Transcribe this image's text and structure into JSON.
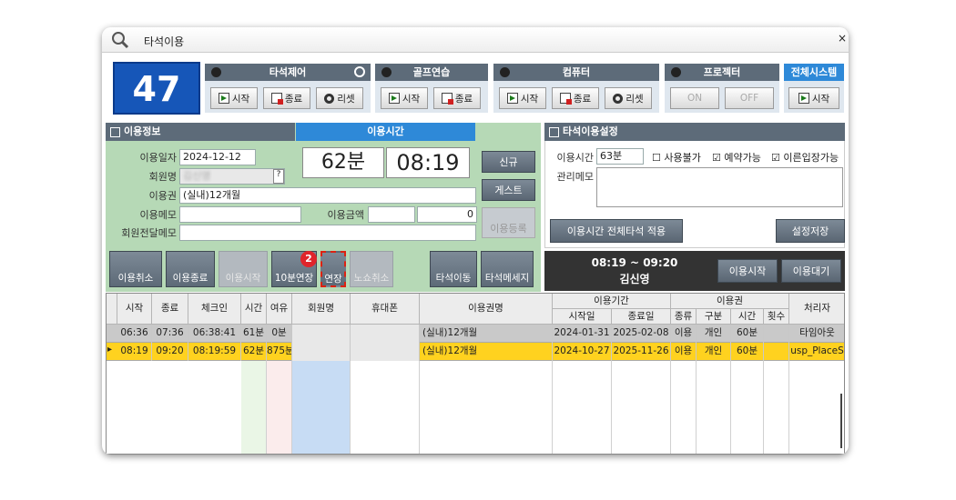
{
  "window": {
    "title": "타석이용",
    "close": "×"
  },
  "seat_number": "47",
  "groups": {
    "bay": {
      "title": "타석제어",
      "start": "시작",
      "end": "종료",
      "reset": "리셋"
    },
    "golf": {
      "title": "골프연습",
      "start": "시작",
      "end": "종료"
    },
    "computer": {
      "title": "컴퓨터",
      "start": "시작",
      "end": "종료",
      "reset": "리셋"
    },
    "projector": {
      "title": "프로젝터",
      "on": "ON",
      "off": "OFF"
    },
    "system": {
      "title": "전체시스템",
      "start": "시작"
    }
  },
  "usage_info": {
    "title": "이용정보",
    "date_label": "이용일자",
    "date": "2024-12-12",
    "member_label": "회원명",
    "member": "김신영",
    "ticket_label": "이용권",
    "ticket": "(실내)12개월",
    "memo_label": "이용메모",
    "memo": "",
    "amount_label": "이용금액",
    "amount": "0",
    "note_label": "회원전달메모",
    "note": ""
  },
  "usage_time": {
    "title": "이용시간",
    "minutes": "62분",
    "clock": "08:19"
  },
  "side_buttons": {
    "new": "신규",
    "guest": "게스트",
    "register": "이용등록"
  },
  "bottom_buttons": {
    "cancel": "이용취소",
    "end": "이용종료",
    "start": "이용시작",
    "extend10": "10분연장",
    "extend": "연장",
    "no_show": "노쇼취소",
    "move": "타석이동",
    "message": "타석메세지"
  },
  "callout": "2",
  "settings": {
    "title": "타석이용설정",
    "time_label": "이용시간",
    "time_value": "63분",
    "unavailable": "사용불가",
    "reservable": "예약가능",
    "early_entry": "이른입장가능",
    "admin_memo_label": "관리메모",
    "apply_all": "이용시간 전체타석 적용",
    "save": "설정저장"
  },
  "status": {
    "time_range": "08:19 ~ 09:20",
    "name": "김신영",
    "start_btn": "이용시작",
    "wait_btn": "이용대기"
  },
  "table": {
    "headers": [
      "시작",
      "종료",
      "체크인",
      "시간",
      "여유",
      "회원명",
      "휴대폰",
      "이용권명"
    ],
    "period": "이용기간",
    "period_start": "시작일",
    "period_end": "종료일",
    "ticket": "이용권",
    "t_type": "종류",
    "t_kind": "구분",
    "t_time": "시간",
    "t_count": "횟수",
    "processor": "처리자",
    "rows": [
      {
        "start": "06:36",
        "end": "07:36",
        "checkin": "06:38:41",
        "time": "61분",
        "spare": "0분",
        "name": "",
        "phone": "",
        "ticket": "(실내)12개월",
        "pstart": "2024-01-31",
        "pend": "2025-02-08",
        "type": "이용",
        "kind": "개인",
        "ttime": "60분",
        "count": "",
        "proc": "타임아웃"
      },
      {
        "start": "08:19",
        "end": "09:20",
        "checkin": "08:19:59",
        "time": "62분",
        "spare": "875분",
        "name": "",
        "phone": "",
        "ticket": "(실내)12개월",
        "pstart": "2024-10-27",
        "pend": "2025-11-26",
        "type": "이용",
        "kind": "개인",
        "ttime": "60분",
        "count": "",
        "proc": "usp_PlaceS"
      }
    ]
  },
  "colors": {
    "accent": "#1656b8",
    "header": "#5d6b79",
    "highlight": "#ffd21f",
    "panel": "#b6d9b6"
  }
}
